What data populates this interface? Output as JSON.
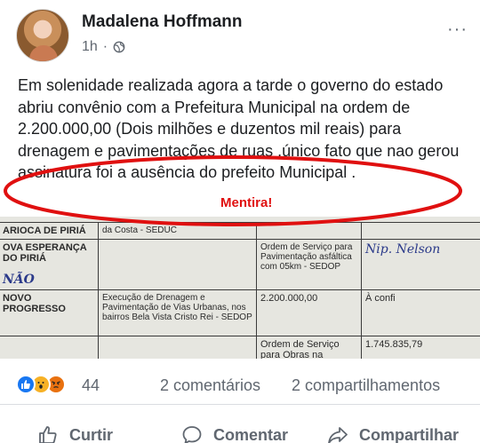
{
  "post": {
    "author": "Madalena Hoffmann",
    "time": "1h",
    "separator": "·",
    "more": "···",
    "text": "Em solenidade realizada agora a tarde o governo do estado abriu convênio  com a Prefeitura Municipal na ordem de 2.200.000,00 (Dois milhões  e duzentos mil reais) para drenagem e pavimentações de ruas .único fato que nao gerou assinatura foi a ausência  do prefeito  Municipal ."
  },
  "annotation": {
    "label": "Mentira!",
    "color": "#e01010"
  },
  "document": {
    "rows": [
      [
        "ARIOCA DE PIRIÁ",
        "da Costa - SEDUC",
        "",
        ""
      ],
      [
        "OVA ESPERANÇA DO PIRIÁ",
        "",
        "Ordem de Serviço para Pavimentação asfáltica com 05km - SEDOP",
        ""
      ],
      [
        "NOVO PROGRESSO",
        "Execução de Drenagem e Pavimentação de Vias Urbanas, nos bairros Bela Vista Cristo Rei - SEDOP",
        "2.200.000,00",
        "À confi"
      ],
      [
        "",
        "",
        "Ordem de Serviço para Obras na",
        "1.745.835,79"
      ]
    ],
    "handwriting": [
      "NÃO",
      "Nip. Nelson",
      "À conf"
    ]
  },
  "reactions": {
    "count": "44",
    "comments": "2 comentários",
    "shares": "2 compartilhamentos"
  },
  "actions": {
    "like": "Curtir",
    "comment": "Comentar",
    "share": "Compartilhar"
  },
  "colors": {
    "like_blue": "#1877f2",
    "text_gray": "#606770"
  }
}
